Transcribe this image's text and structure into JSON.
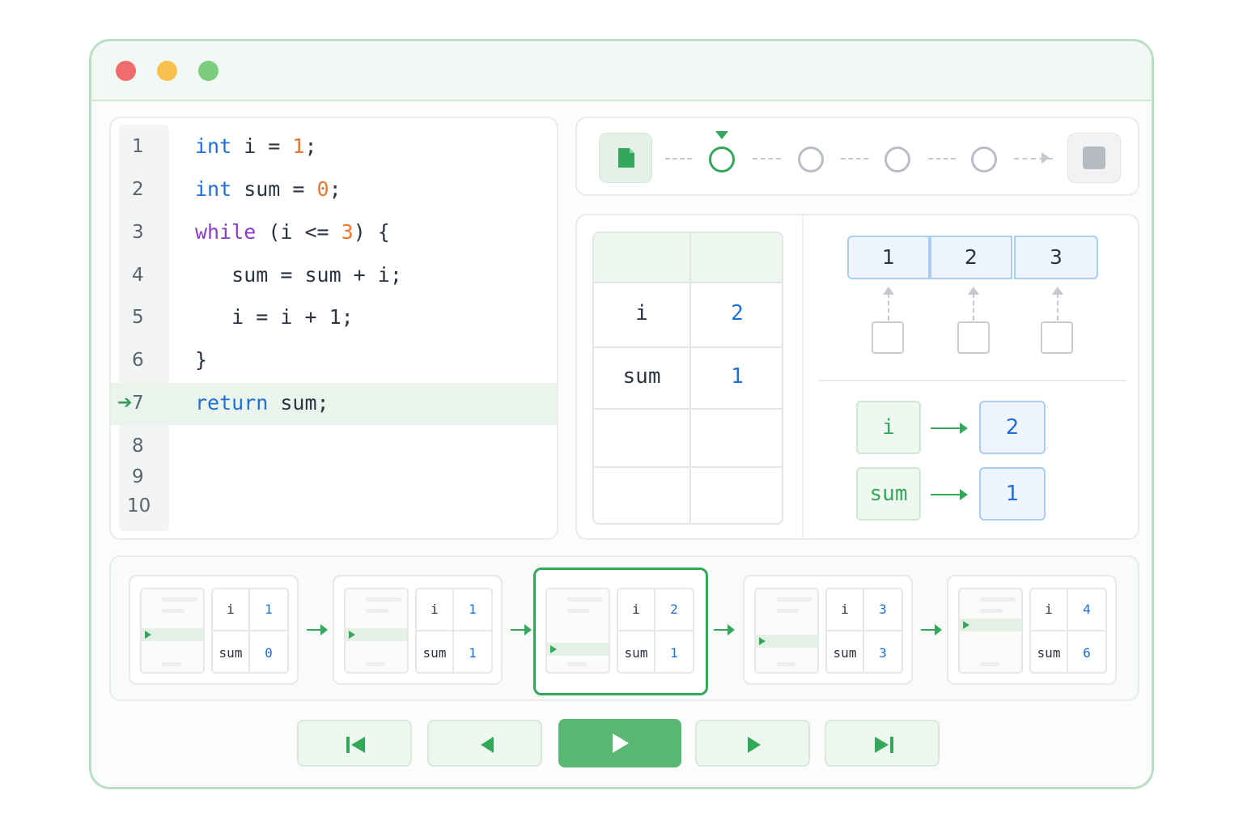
{
  "window": {
    "controls": [
      "close",
      "minimize",
      "maximize"
    ]
  },
  "code": {
    "lines": [
      {
        "num": "1",
        "tokens": [
          {
            "t": "int",
            "c": "kw-blue"
          },
          {
            "t": " i = "
          },
          {
            "t": "1",
            "c": "num"
          },
          {
            "t": ";"
          }
        ]
      },
      {
        "num": "2",
        "tokens": [
          {
            "t": "int",
            "c": "kw-blue"
          },
          {
            "t": " sum = "
          },
          {
            "t": "0",
            "c": "num"
          },
          {
            "t": ";"
          }
        ]
      },
      {
        "num": "3",
        "tokens": [
          {
            "t": "while",
            "c": "kw-purple"
          },
          {
            "t": " (i <= "
          },
          {
            "t": "3",
            "c": "num"
          },
          {
            "t": ") {"
          }
        ]
      },
      {
        "num": "4",
        "tokens": [
          {
            "t": "   sum = sum + i;"
          }
        ]
      },
      {
        "num": "5",
        "tokens": [
          {
            "t": "   i = i + 1;"
          }
        ]
      },
      {
        "num": "6",
        "tokens": [
          {
            "t": "}"
          }
        ]
      },
      {
        "num": "7",
        "tokens": [
          {
            "t": "return",
            "c": "kw-blue"
          },
          {
            "t": " sum;"
          }
        ]
      },
      {
        "num": "8",
        "tokens": []
      },
      {
        "num": "9",
        "tokens": []
      },
      {
        "num": "10",
        "tokens": []
      }
    ],
    "current_line": "7",
    "current_marker": "➔"
  },
  "variables": {
    "table": [
      {
        "name": "i",
        "value": "2"
      },
      {
        "name": "sum",
        "value": "1"
      }
    ],
    "array": [
      "1",
      "2",
      "3"
    ],
    "bindings": [
      {
        "name": "i",
        "value": "2"
      },
      {
        "name": "sum",
        "value": "1"
      }
    ]
  },
  "steps": {
    "count": 4,
    "active_index": 0,
    "start_icon": "file-icon",
    "end_icon": "stop-icon"
  },
  "timeline": [
    {
      "i": "1",
      "sum": "0",
      "active": false
    },
    {
      "i": "1",
      "sum": "1",
      "active": false
    },
    {
      "i": "2",
      "sum": "1",
      "active": true
    },
    {
      "i": "3",
      "sum": "3",
      "active": false
    },
    {
      "i": "4",
      "sum": "6",
      "active": false
    }
  ],
  "timeline_var_names": {
    "i": "i",
    "sum": "sum"
  },
  "playback": {
    "buttons": [
      "first-step",
      "previous-step",
      "play",
      "next-step",
      "last-step"
    ]
  },
  "colors": {
    "accent": "#34a85a",
    "value_blue": "#1f6fd6",
    "keyword_purple": "#8a3fc6",
    "number_orange": "#e8772e"
  }
}
